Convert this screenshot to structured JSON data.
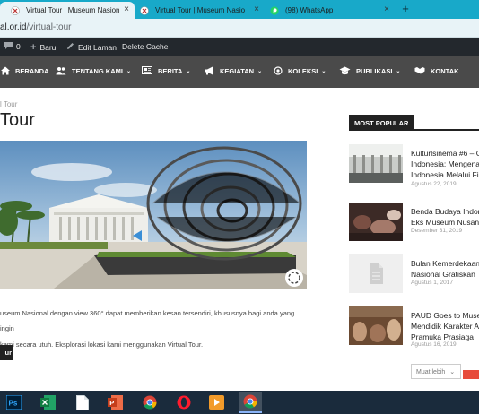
{
  "browser": {
    "tabs": [
      {
        "label": "Virtual Tour | Museum Nasional I",
        "active": true
      },
      {
        "label": "Virtual Tour | Museum Nasional I",
        "active": false
      },
      {
        "label": "(98) WhatsApp",
        "active": false
      }
    ],
    "close_glyph": "×",
    "new_tab_glyph": "+",
    "url_host": "al.or.id",
    "url_path": "/virtual-tour"
  },
  "adminbar": {
    "comments_count": "0",
    "new_label": "Baru",
    "edit_label": "Edit Laman",
    "cache_label": "Delete Cache"
  },
  "nav": {
    "items": [
      {
        "label": "BERANDA",
        "icon": "home-icon",
        "has_caret": false
      },
      {
        "label": "TENTANG KAMI",
        "icon": "users-icon",
        "has_caret": true
      },
      {
        "label": "BERITA",
        "icon": "newspaper-icon",
        "has_caret": true
      },
      {
        "label": "KEGIATAN",
        "icon": "megaphone-icon",
        "has_caret": true
      },
      {
        "label": "KOLEKSI",
        "icon": "target-icon",
        "has_caret": true
      },
      {
        "label": "PUBLIKASI",
        "icon": "graduation-cap-icon",
        "has_caret": true
      },
      {
        "label": "KONTAK",
        "icon": "handshake-icon",
        "has_caret": false
      }
    ],
    "caret_glyph": "⌄"
  },
  "content": {
    "breadcrumb": "l Tour",
    "title": "Tour",
    "description_line1": "useum Nasional dengan view 360° dapat memberikan kesan tersendiri, khususnya bagi anda yang ingin",
    "description_line2": "kami secara utuh. Eksplorasi lokasi kami menggunakan Virtual Tour.",
    "cta_label": "ur"
  },
  "sidebar": {
    "heading": "MOST POPULAR",
    "posts": [
      {
        "title_lines": [
          "Kulturlsinema #6 – C",
          "Indonesia: Mengenal",
          "Indonesia Melalui Fi"
        ],
        "date": "Agustus 22, 2019"
      },
      {
        "title_lines": [
          "Benda Budaya Indon",
          "Eks Museum Nusant"
        ],
        "date": "Desember 31, 2019"
      },
      {
        "title_lines": [
          "Bulan Kemerdekaan",
          "Nasional Gratiskan T"
        ],
        "date": "Agustus 1, 2017"
      },
      {
        "title_lines": [
          "PAUD Goes to Muse",
          "Mendidik Karakter A",
          "Pramuka Prasiaga"
        ],
        "date": "Agustus 16, 2019"
      }
    ],
    "more_label": "Muat lebih",
    "more_caret": "⌄"
  },
  "taskbar": {
    "apps": [
      "photoshop-icon",
      "excel-icon",
      "file-icon",
      "powerpoint-icon",
      "chrome-icon",
      "opera-icon",
      "media-player-icon",
      "chrome-active-icon"
    ]
  },
  "colors": {
    "tabstrip": "#18a9c9",
    "adminbar": "#23282d",
    "nav": "#4a4a4a",
    "taskbar": "#1a2b3c",
    "accent_red": "#e74c3c"
  }
}
